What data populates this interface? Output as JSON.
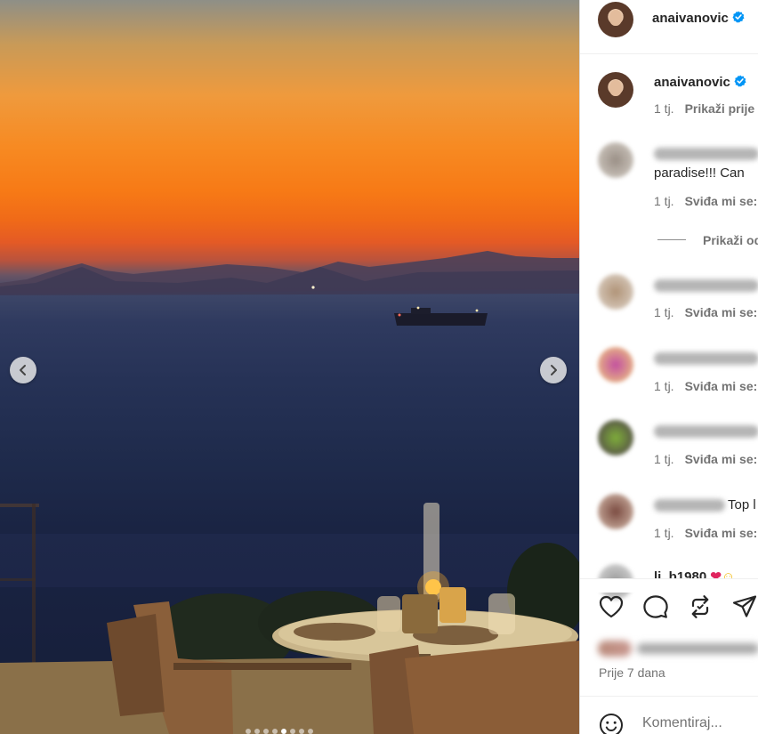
{
  "post": {
    "author": "anaivanovic",
    "carousel": {
      "slide_count": 8,
      "active_index": 4
    },
    "caption_author": "anaivanovic",
    "caption_meta": {
      "time": "1 tj.",
      "action": "Prikaži prije"
    }
  },
  "comments": [
    {
      "text": "paradise!!! Can",
      "time": "1 tj.",
      "like": "Sviđa mi se:"
    },
    {
      "text": "",
      "time": "1 tj.",
      "like": "Sviđa mi se:"
    },
    {
      "text": "",
      "time": "1 tj.",
      "like": "Sviđa mi se:"
    },
    {
      "text": "",
      "time": "1 tj.",
      "like": "Sviđa mi se:"
    },
    {
      "text": "Top l",
      "time": "1 tj.",
      "like": "Sviđa mi se:"
    },
    {
      "name": "li_b1980",
      "text": ""
    }
  ],
  "show_replies": "Prikaži od",
  "actions": {
    "like_icon": "heart-icon",
    "comment_icon": "comment-icon",
    "repost_icon": "repost-icon",
    "share_icon": "share-icon"
  },
  "date": "Prije 7 dana",
  "comment_box": {
    "placeholder": "Komentiraj..."
  },
  "colors": {
    "verified": "#0095f6",
    "muted": "#737373",
    "text": "#262626"
  }
}
